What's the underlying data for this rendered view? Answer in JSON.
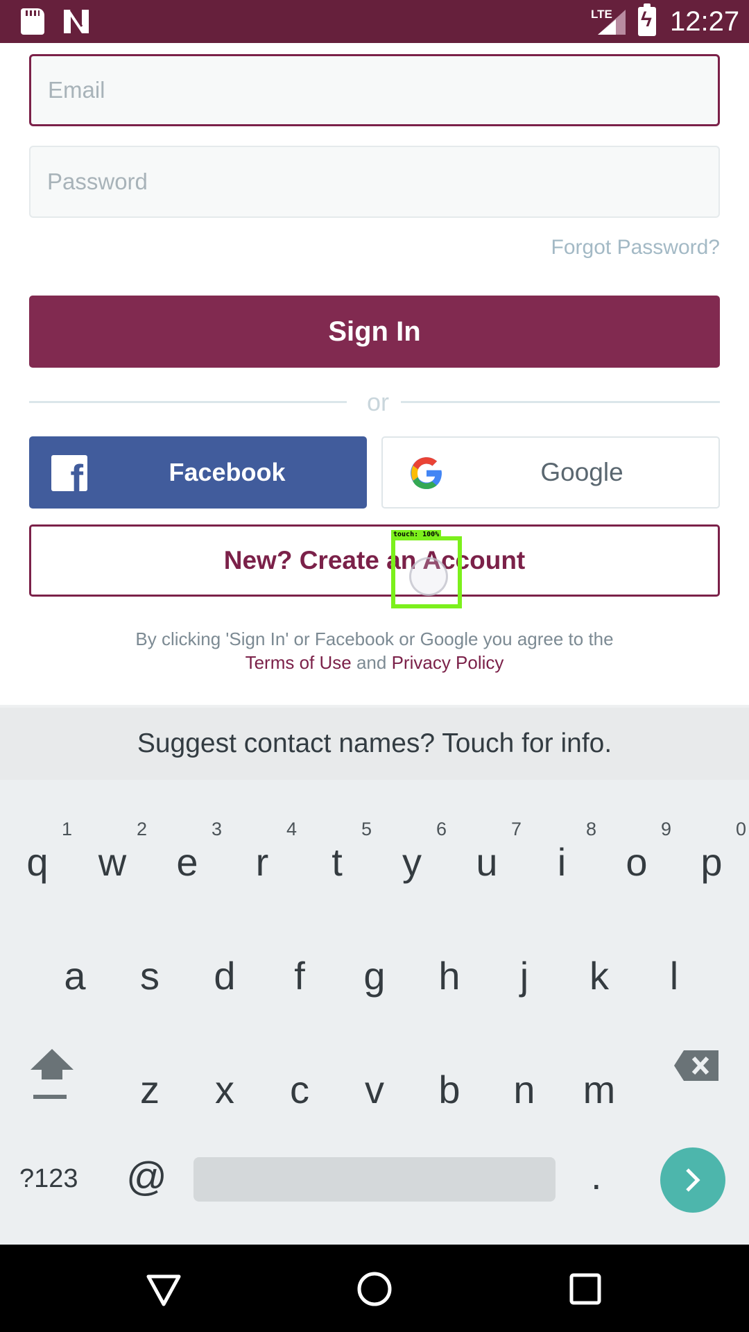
{
  "status_bar": {
    "network": "LTE",
    "time": "12:27",
    "icons": [
      "sd-card-icon",
      "n-notification-icon",
      "signal-icon",
      "battery-charging-icon"
    ]
  },
  "login": {
    "email_placeholder": "Email",
    "password_placeholder": "Password",
    "forgot_password": "Forgot Password?",
    "sign_in": "Sign In",
    "or": "or",
    "facebook": "Facebook",
    "google": "Google",
    "create_account": "New? Create an Account",
    "legal_prefix": "By clicking 'Sign In' or Facebook or Google you agree to the",
    "terms": "Terms of Use",
    "and": "and",
    "privacy": "Privacy Policy"
  },
  "touch_overlay": {
    "label": "touch: 100%"
  },
  "keyboard": {
    "suggestion": "Suggest contact names? Touch for info.",
    "row1": [
      "q",
      "w",
      "e",
      "r",
      "t",
      "y",
      "u",
      "i",
      "o",
      "p"
    ],
    "row1_hints": [
      "1",
      "2",
      "3",
      "4",
      "5",
      "6",
      "7",
      "8",
      "9",
      "0"
    ],
    "row2": [
      "a",
      "s",
      "d",
      "f",
      "g",
      "h",
      "j",
      "k",
      "l"
    ],
    "row3": [
      "z",
      "x",
      "c",
      "v",
      "b",
      "n",
      "m"
    ],
    "symbols": "?123",
    "at": "@",
    "period": ".",
    "accent_color": "#4db6ac"
  },
  "colors": {
    "brand": "#812a50",
    "status_bar": "#66203c",
    "facebook": "#415c9c"
  }
}
